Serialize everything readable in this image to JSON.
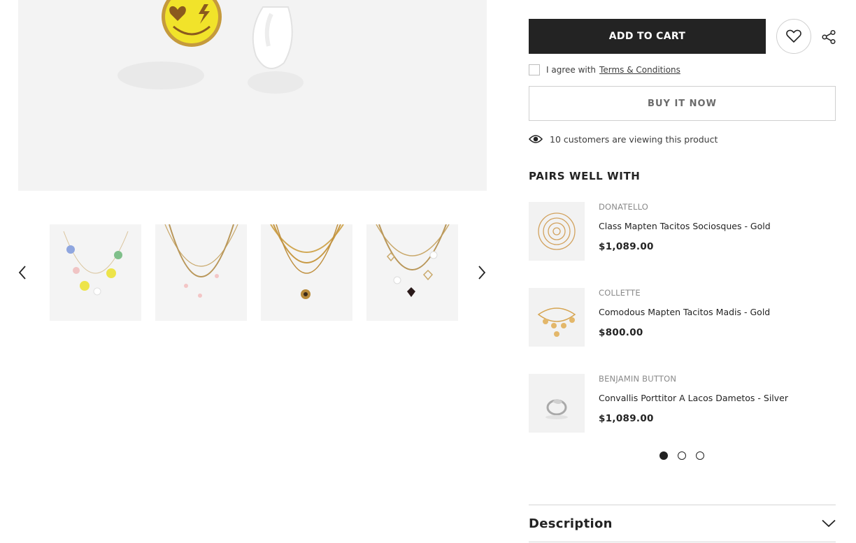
{
  "gallery": {
    "main_image_icon": "earrings-product-image",
    "prev_icon": "chevron-left-icon",
    "next_icon": "chevron-right-icon",
    "thumbnails": [
      {
        "icon": "charm-necklace-thumbnail"
      },
      {
        "icon": "layered-necklace-thumbnail"
      },
      {
        "icon": "gold-chain-necklace-thumbnail"
      },
      {
        "icon": "heart-charm-necklace-thumbnail"
      }
    ]
  },
  "actions": {
    "add_to_cart_label": "ADD TO CART",
    "wishlist_icon": "heart-icon",
    "share_icon": "share-icon",
    "agree_text": "I agree with",
    "terms_link": "Terms & Conditions",
    "buy_now_label": "BUY IT NOW"
  },
  "viewing": {
    "icon": "eye-icon",
    "text": "10 customers are viewing this product"
  },
  "pairs": {
    "title": "PAIRS WELL WITH",
    "items": [
      {
        "vendor": "DONATELLO",
        "name": "Class Mapten Tacitos Sociosques - Gold",
        "price": "$1,089.00",
        "icon": "spiral-earrings-image"
      },
      {
        "vendor": "COLLETTE",
        "name": "Comodous Mapten Tacitos Madis - Gold",
        "price": "$800.00",
        "icon": "charm-bracelet-image"
      },
      {
        "vendor": "BENJAMIN BUTTON",
        "name": "Convallis Porttitor A Lacos Dametos - Silver",
        "price": "$1,089.00",
        "icon": "silver-ring-image"
      }
    ],
    "pagination": {
      "pages": 3,
      "active": 1
    }
  },
  "description": {
    "title": "Description",
    "icon": "chevron-down-icon"
  },
  "colors": {
    "primary": "#232323",
    "border": "#cfcfcf",
    "image_bg": "#f3f3f3"
  }
}
